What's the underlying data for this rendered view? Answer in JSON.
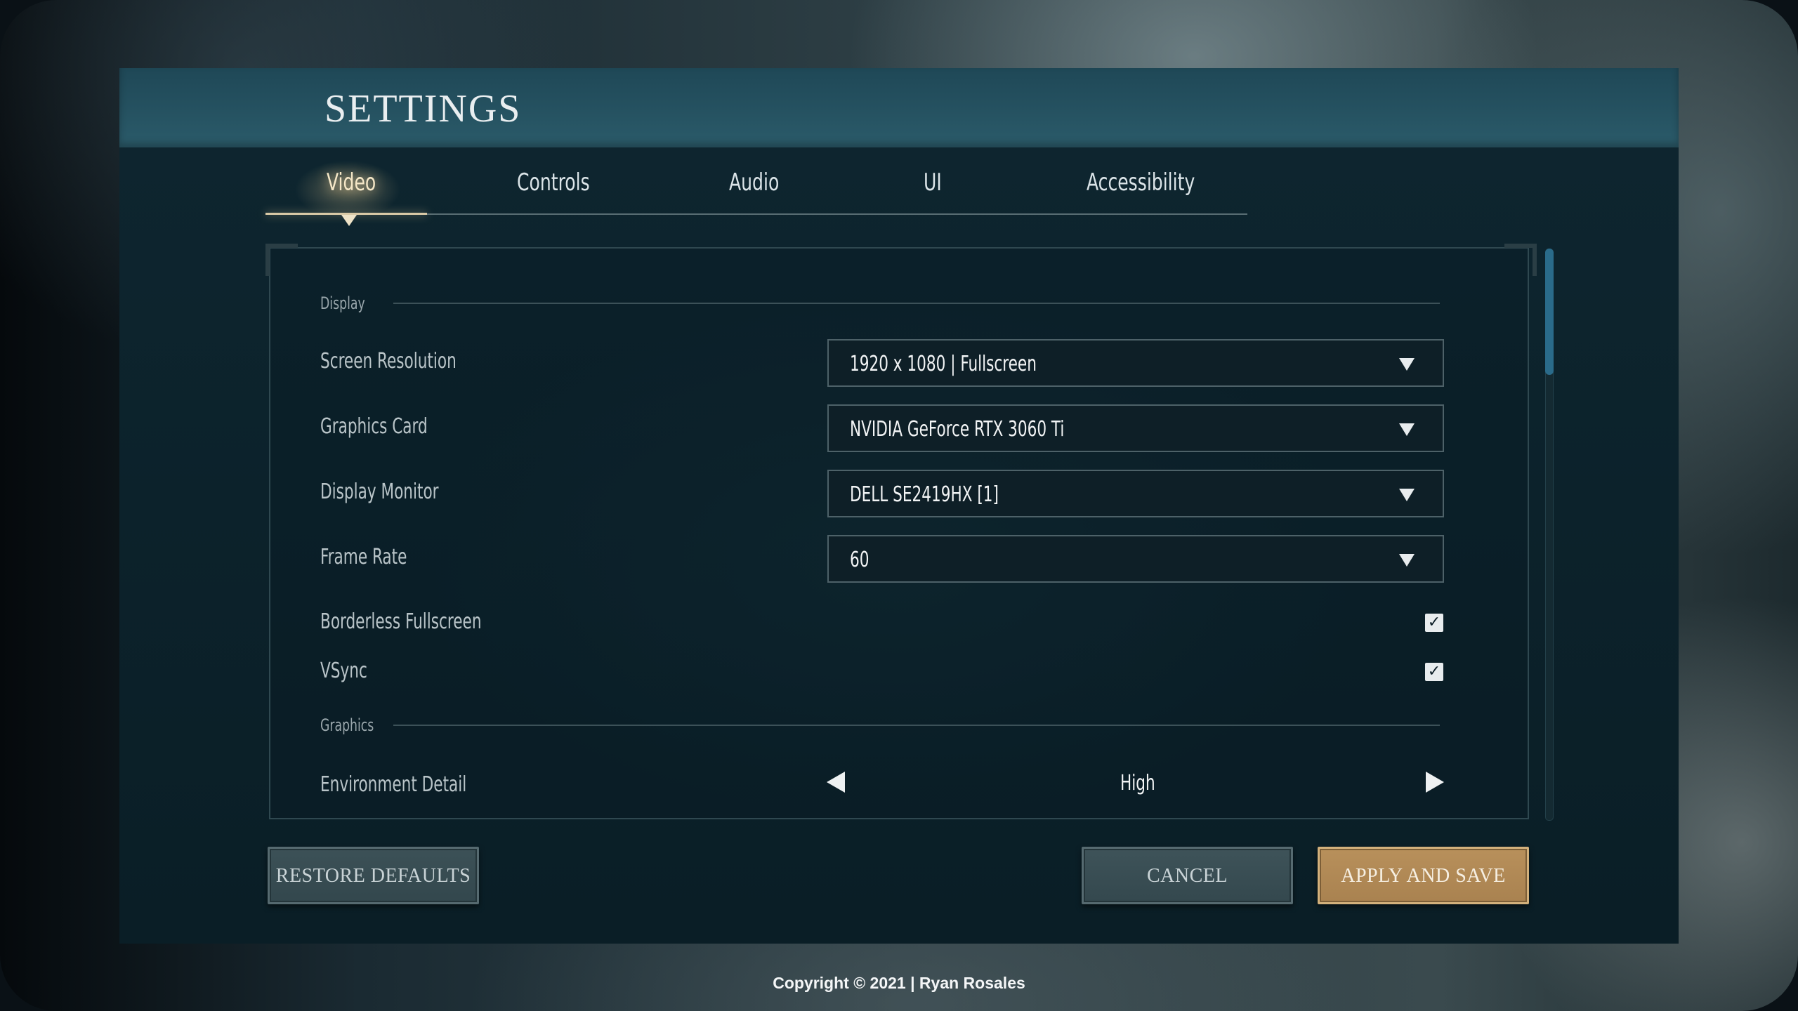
{
  "window": {
    "title": "SETTINGS"
  },
  "tabs": [
    {
      "label": "Video",
      "active": true
    },
    {
      "label": "Controls",
      "active": false
    },
    {
      "label": "Audio",
      "active": false
    },
    {
      "label": "UI",
      "active": false
    },
    {
      "label": "Accessibility",
      "active": false
    }
  ],
  "sections": {
    "display": "Display",
    "graphics": "Graphics"
  },
  "settings": {
    "screen_resolution": {
      "label": "Screen Resolution",
      "value": "1920 x 1080 | Fullscreen"
    },
    "graphics_card": {
      "label": "Graphics Card",
      "value": "NVIDIA GeForce RTX 3060 Ti"
    },
    "display_monitor": {
      "label": "Display Monitor",
      "value": "DELL SE2419HX [1]"
    },
    "frame_rate": {
      "label": "Frame Rate",
      "value": "60"
    },
    "borderless_fullscreen": {
      "label": "Borderless Fullscreen",
      "checked": true
    },
    "vsync": {
      "label": "VSync",
      "checked": true
    },
    "environment_detail": {
      "label": "Environment Detail",
      "value": "High"
    }
  },
  "buttons": {
    "restore_defaults": "RESTORE DEFAULTS",
    "cancel": "CANCEL",
    "apply_and_save": "APPLY AND SAVE"
  },
  "icons": {
    "dropdown": "chevron-down-icon",
    "checkbox": "check-icon",
    "stepper_prev": "arrow-left-icon",
    "stepper_next": "arrow-right-icon"
  },
  "colors": {
    "accent_gold": "#b8905b",
    "active_tab": "#f5e7c7",
    "scroll_thumb": "#2a6b8a"
  },
  "footer": {
    "copyright": "Copyright © 2021 | Ryan Rosales"
  }
}
